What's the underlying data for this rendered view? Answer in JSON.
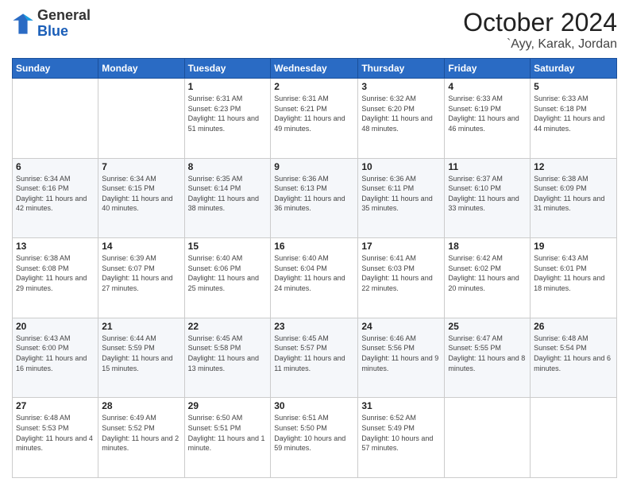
{
  "header": {
    "logo_line1": "General",
    "logo_line2": "Blue",
    "month": "October 2024",
    "location": "`Ayy, Karak, Jordan"
  },
  "days_of_week": [
    "Sunday",
    "Monday",
    "Tuesday",
    "Wednesday",
    "Thursday",
    "Friday",
    "Saturday"
  ],
  "weeks": [
    [
      {
        "day": "",
        "info": ""
      },
      {
        "day": "",
        "info": ""
      },
      {
        "day": "1",
        "info": "Sunrise: 6:31 AM\nSunset: 6:23 PM\nDaylight: 11 hours and 51 minutes."
      },
      {
        "day": "2",
        "info": "Sunrise: 6:31 AM\nSunset: 6:21 PM\nDaylight: 11 hours and 49 minutes."
      },
      {
        "day": "3",
        "info": "Sunrise: 6:32 AM\nSunset: 6:20 PM\nDaylight: 11 hours and 48 minutes."
      },
      {
        "day": "4",
        "info": "Sunrise: 6:33 AM\nSunset: 6:19 PM\nDaylight: 11 hours and 46 minutes."
      },
      {
        "day": "5",
        "info": "Sunrise: 6:33 AM\nSunset: 6:18 PM\nDaylight: 11 hours and 44 minutes."
      }
    ],
    [
      {
        "day": "6",
        "info": "Sunrise: 6:34 AM\nSunset: 6:16 PM\nDaylight: 11 hours and 42 minutes."
      },
      {
        "day": "7",
        "info": "Sunrise: 6:34 AM\nSunset: 6:15 PM\nDaylight: 11 hours and 40 minutes."
      },
      {
        "day": "8",
        "info": "Sunrise: 6:35 AM\nSunset: 6:14 PM\nDaylight: 11 hours and 38 minutes."
      },
      {
        "day": "9",
        "info": "Sunrise: 6:36 AM\nSunset: 6:13 PM\nDaylight: 11 hours and 36 minutes."
      },
      {
        "day": "10",
        "info": "Sunrise: 6:36 AM\nSunset: 6:11 PM\nDaylight: 11 hours and 35 minutes."
      },
      {
        "day": "11",
        "info": "Sunrise: 6:37 AM\nSunset: 6:10 PM\nDaylight: 11 hours and 33 minutes."
      },
      {
        "day": "12",
        "info": "Sunrise: 6:38 AM\nSunset: 6:09 PM\nDaylight: 11 hours and 31 minutes."
      }
    ],
    [
      {
        "day": "13",
        "info": "Sunrise: 6:38 AM\nSunset: 6:08 PM\nDaylight: 11 hours and 29 minutes."
      },
      {
        "day": "14",
        "info": "Sunrise: 6:39 AM\nSunset: 6:07 PM\nDaylight: 11 hours and 27 minutes."
      },
      {
        "day": "15",
        "info": "Sunrise: 6:40 AM\nSunset: 6:06 PM\nDaylight: 11 hours and 25 minutes."
      },
      {
        "day": "16",
        "info": "Sunrise: 6:40 AM\nSunset: 6:04 PM\nDaylight: 11 hours and 24 minutes."
      },
      {
        "day": "17",
        "info": "Sunrise: 6:41 AM\nSunset: 6:03 PM\nDaylight: 11 hours and 22 minutes."
      },
      {
        "day": "18",
        "info": "Sunrise: 6:42 AM\nSunset: 6:02 PM\nDaylight: 11 hours and 20 minutes."
      },
      {
        "day": "19",
        "info": "Sunrise: 6:43 AM\nSunset: 6:01 PM\nDaylight: 11 hours and 18 minutes."
      }
    ],
    [
      {
        "day": "20",
        "info": "Sunrise: 6:43 AM\nSunset: 6:00 PM\nDaylight: 11 hours and 16 minutes."
      },
      {
        "day": "21",
        "info": "Sunrise: 6:44 AM\nSunset: 5:59 PM\nDaylight: 11 hours and 15 minutes."
      },
      {
        "day": "22",
        "info": "Sunrise: 6:45 AM\nSunset: 5:58 PM\nDaylight: 11 hours and 13 minutes."
      },
      {
        "day": "23",
        "info": "Sunrise: 6:45 AM\nSunset: 5:57 PM\nDaylight: 11 hours and 11 minutes."
      },
      {
        "day": "24",
        "info": "Sunrise: 6:46 AM\nSunset: 5:56 PM\nDaylight: 11 hours and 9 minutes."
      },
      {
        "day": "25",
        "info": "Sunrise: 6:47 AM\nSunset: 5:55 PM\nDaylight: 11 hours and 8 minutes."
      },
      {
        "day": "26",
        "info": "Sunrise: 6:48 AM\nSunset: 5:54 PM\nDaylight: 11 hours and 6 minutes."
      }
    ],
    [
      {
        "day": "27",
        "info": "Sunrise: 6:48 AM\nSunset: 5:53 PM\nDaylight: 11 hours and 4 minutes."
      },
      {
        "day": "28",
        "info": "Sunrise: 6:49 AM\nSunset: 5:52 PM\nDaylight: 11 hours and 2 minutes."
      },
      {
        "day": "29",
        "info": "Sunrise: 6:50 AM\nSunset: 5:51 PM\nDaylight: 11 hours and 1 minute."
      },
      {
        "day": "30",
        "info": "Sunrise: 6:51 AM\nSunset: 5:50 PM\nDaylight: 10 hours and 59 minutes."
      },
      {
        "day": "31",
        "info": "Sunrise: 6:52 AM\nSunset: 5:49 PM\nDaylight: 10 hours and 57 minutes."
      },
      {
        "day": "",
        "info": ""
      },
      {
        "day": "",
        "info": ""
      }
    ]
  ]
}
